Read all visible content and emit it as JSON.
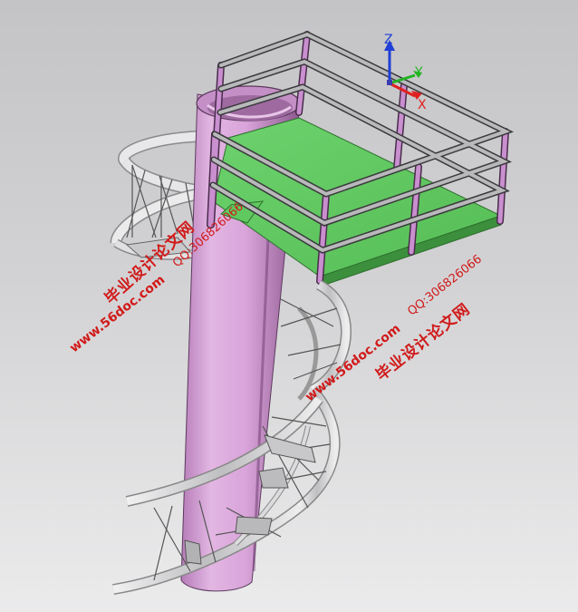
{
  "triad": {
    "z_label": "Z",
    "y_label": "Y",
    "x_label": "X",
    "colors": {
      "z": "#1f3fd6",
      "y": "#22b422",
      "x": "#e02020"
    }
  },
  "watermarks": [
    {
      "cn": "毕业设计论文网",
      "url": "www.56doc.com",
      "qq": "QQ:306826066"
    },
    {
      "cn": "毕业设计论文网",
      "url": "www.56doc.com",
      "qq": "QQ:306826066"
    }
  ],
  "colors": {
    "column": "#d79ed7",
    "platform": "#66cc66",
    "railing": "#c58ec9",
    "stairs": "#d8d8da",
    "watermark": "#d11a1a"
  }
}
